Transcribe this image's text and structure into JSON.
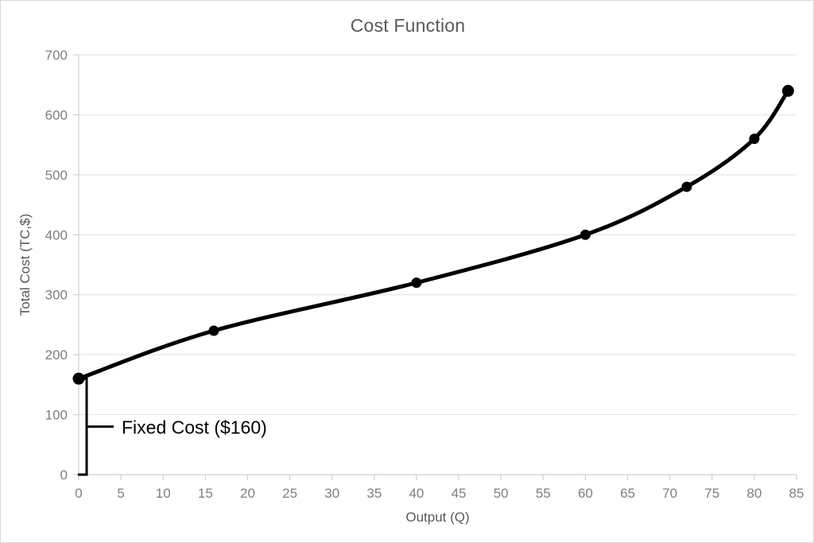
{
  "chart_data": {
    "type": "line",
    "title": "Cost Function",
    "xlabel": "Output (Q)",
    "ylabel": "Total Cost (TC,$)",
    "xlim": [
      0,
      85
    ],
    "ylim": [
      0,
      700
    ],
    "grid": "horizontal",
    "legend": "none",
    "marker": "filled-circle",
    "line_color": "#000000",
    "x": [
      0,
      16,
      40,
      60,
      72,
      80,
      84
    ],
    "values": [
      160,
      240,
      320,
      400,
      480,
      560,
      640
    ],
    "points": [
      {
        "q": 0,
        "tc": 160
      },
      {
        "q": 16,
        "tc": 240
      },
      {
        "q": 40,
        "tc": 320
      },
      {
        "q": 60,
        "tc": 400
      },
      {
        "q": 72,
        "tc": 480
      },
      {
        "q": 80,
        "tc": 560
      },
      {
        "q": 84,
        "tc": 640
      }
    ],
    "xticks": [
      0,
      5,
      10,
      15,
      20,
      25,
      30,
      35,
      40,
      45,
      50,
      55,
      60,
      65,
      70,
      75,
      80,
      85
    ],
    "yticks": [
      0,
      100,
      200,
      300,
      400,
      500,
      600,
      700
    ],
    "annotations": [
      {
        "text": "Fixed Cost ($160)",
        "span_y": [
          0,
          160
        ],
        "span_x": 0,
        "style": "brace-with-leader"
      }
    ]
  },
  "colors": {
    "title": "#595959",
    "tick_label": "#7f7f7f",
    "axis_title": "#595959",
    "gridline": "#e6e6e6",
    "axis_line": "#d0d0d0",
    "series": "#000000",
    "annotation": "#000000",
    "background": "#ffffff",
    "border": "#d9d9d9"
  }
}
